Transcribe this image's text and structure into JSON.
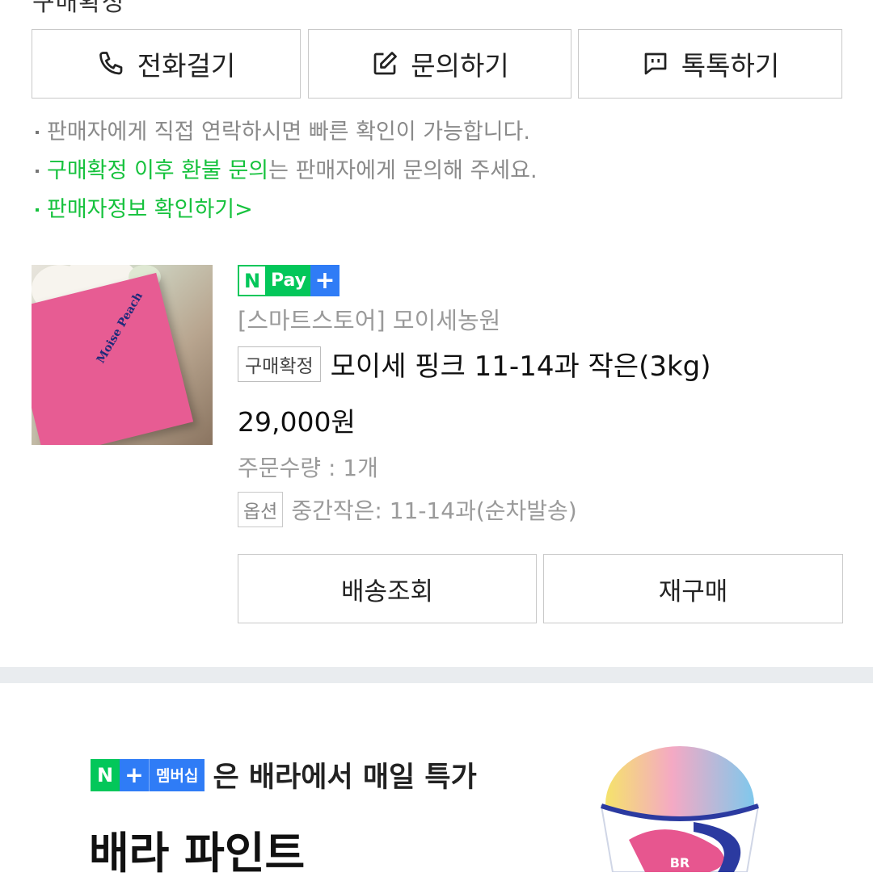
{
  "top_partial_text": "구매확정",
  "contact_buttons": [
    {
      "label": "전화걸기",
      "icon": "phone-icon"
    },
    {
      "label": "문의하기",
      "icon": "edit-icon"
    },
    {
      "label": "톡톡하기",
      "icon": "chat-icon"
    }
  ],
  "notices": {
    "line1": "판매자에게 직접 연락하시면 빠른 확인이 가능합니다.",
    "line2_highlight": "구매확정 이후 환불 문의",
    "line2_rest": "는 판매자에게 문의해 주세요.",
    "line3": "판매자정보 확인하기",
    "line3_chevron": ">"
  },
  "product": {
    "image_text": "Moise Peach",
    "npay_n": "N",
    "npay_pay": "Pay",
    "npay_plus": "+",
    "store": "[스마트스토어] 모이세농원",
    "status_badge": "구매확정",
    "name": "모이세 핑크 11-14과 작은(3kg)",
    "price": "29,000원",
    "quantity": "주문수량 : 1개",
    "option_badge": "옵션",
    "option_value": "중간작은: 11-14과(순차발송)"
  },
  "actions": {
    "track": "배송조회",
    "rebuy": "재구매"
  },
  "banner": {
    "n": "N",
    "plus": "+",
    "membership": "멤버십",
    "text": "은 배라에서 매일 특가",
    "title": "배라 파인트",
    "cup_logo": "BR"
  },
  "colors": {
    "accent_green": "#16c23d",
    "npay_green": "#03c75a",
    "membership_blue": "#2f7cf6",
    "divider": "#e9ecef"
  }
}
